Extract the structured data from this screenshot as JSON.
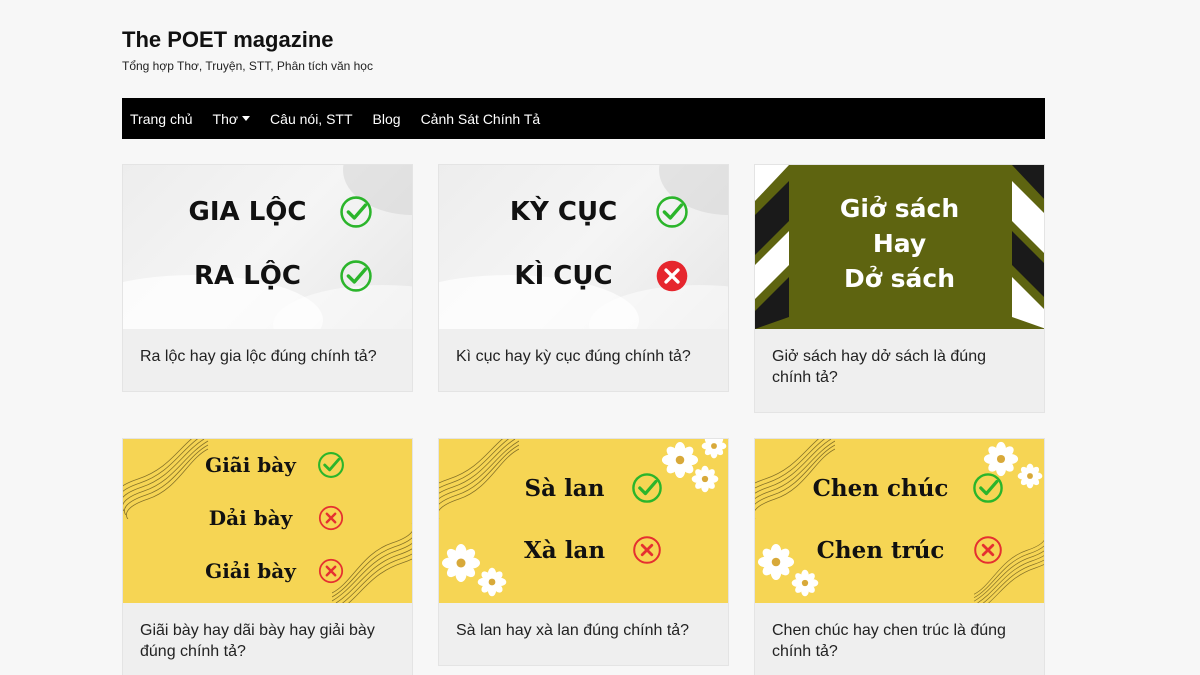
{
  "site": {
    "title": "The POET magazine",
    "tagline": "Tổng hợp Thơ, Truyện, STT, Phân tích văn học"
  },
  "nav": [
    {
      "label": "Trang chủ"
    },
    {
      "label": "Thơ",
      "has_dropdown": true
    },
    {
      "label": "Câu nói, STT"
    },
    {
      "label": "Blog"
    },
    {
      "label": "Cảnh Sát Chính Tả"
    }
  ],
  "colors": {
    "check": "#2bb52b",
    "cross": "#e53030",
    "olive": "#5e6410",
    "yellow": "#f6d554"
  },
  "posts": [
    {
      "caption": "Ra lộc hay gia lộc đúng chính tả?",
      "thumb": {
        "words": [
          "GIA LỘC",
          "RA LỘC"
        ],
        "marks": [
          "check-icon",
          "check-icon"
        ]
      }
    },
    {
      "caption": "Kì cục hay kỳ cục đúng chính tả?",
      "thumb": {
        "words": [
          "KỲ CỤC",
          "KÌ CỤC"
        ],
        "marks": [
          "check-icon",
          "cross-icon"
        ]
      }
    },
    {
      "caption": "Giở sách hay dở sách là đúng chính tả?",
      "thumb": {
        "lines": [
          "Giở sách",
          "Hay",
          "Dở sách"
        ]
      }
    },
    {
      "caption": "Giãi bày hay dãi bày hay giải bày đúng chính tả?",
      "thumb": {
        "words": [
          "Giãi bày",
          "Dải bày",
          "Giải bày"
        ],
        "marks": [
          "check-icon",
          "cross-icon",
          "cross-icon"
        ]
      }
    },
    {
      "caption": "Sà lan hay xà lan đúng chính tả?",
      "thumb": {
        "words": [
          "Sà lan",
          "Xà lan"
        ],
        "marks": [
          "check-icon",
          "cross-icon"
        ]
      }
    },
    {
      "caption": "Chen chúc hay chen trúc là đúng chính tả?",
      "thumb": {
        "words": [
          "Chen chúc",
          "Chen trúc"
        ],
        "marks": [
          "check-icon",
          "cross-icon"
        ]
      }
    }
  ]
}
